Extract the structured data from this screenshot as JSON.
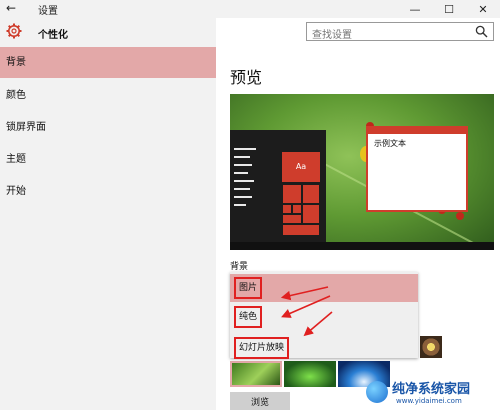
{
  "window": {
    "title": "设置",
    "back_glyph": "←",
    "minimize_glyph": "—",
    "maximize_glyph": "☐",
    "close_glyph": "✕"
  },
  "sidebar": {
    "header": "个性化",
    "items": [
      {
        "label": "背景",
        "selected": true
      },
      {
        "label": "颜色"
      },
      {
        "label": "锁屏界面"
      },
      {
        "label": "主题"
      },
      {
        "label": "开始"
      }
    ]
  },
  "search": {
    "placeholder": "查找设置"
  },
  "main": {
    "title": "预览",
    "preview": {
      "sample_text": "示例文本",
      "tile_label": "Aa"
    },
    "background_label": "背景",
    "dropdown": [
      {
        "label": "图片",
        "selected": true
      },
      {
        "label": "纯色"
      },
      {
        "label": "幻灯片放映"
      }
    ],
    "browse_button": "浏览"
  },
  "colors": {
    "accent": "#cf3d2c",
    "selection": "#e3a8a8",
    "annotation": "#e02020"
  },
  "watermark": {
    "title": "纯净系统家园",
    "url": "www.yidaimei.com"
  }
}
